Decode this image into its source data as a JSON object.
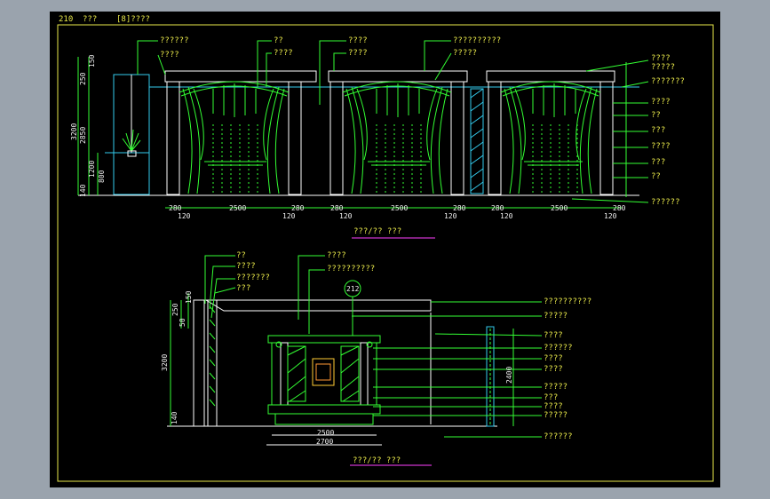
{
  "header": {
    "code": "210",
    "word": "???",
    "bracket": "[8]????"
  },
  "elevation1": {
    "title": "???/?? ???",
    "leaders_top": [
      "??????",
      "????",
      "??",
      "????",
      "????",
      "????",
      "??????????",
      "?????"
    ],
    "leaders_right": [
      "????",
      "?????",
      "???????",
      "????",
      "??",
      "???",
      "????",
      "???",
      "??",
      "??????"
    ],
    "dims_left": [
      "150",
      "250",
      "3200",
      "2850",
      "1200",
      "800",
      "140"
    ],
    "dims_bottom": [
      "280",
      "120",
      "2500",
      "120",
      "280",
      "280",
      "120",
      "2500",
      "120",
      "280",
      "280",
      "120",
      "2500",
      "120",
      "280"
    ]
  },
  "elevation2": {
    "title": "???/?? ???",
    "mark": "212",
    "leaders_left": [
      "??",
      "????",
      "???????",
      "???"
    ],
    "leaders_top": [
      "????",
      "??????????"
    ],
    "leaders_right": [
      "??????????",
      "?????",
      "????",
      "??????",
      "????",
      "????",
      "?????",
      "???",
      "????",
      "?????",
      "??????"
    ],
    "dims_left": [
      "150",
      "250",
      "50",
      "3200",
      "140"
    ],
    "dim_right": "2400",
    "dims_bottom": [
      "2500",
      "2700"
    ]
  }
}
